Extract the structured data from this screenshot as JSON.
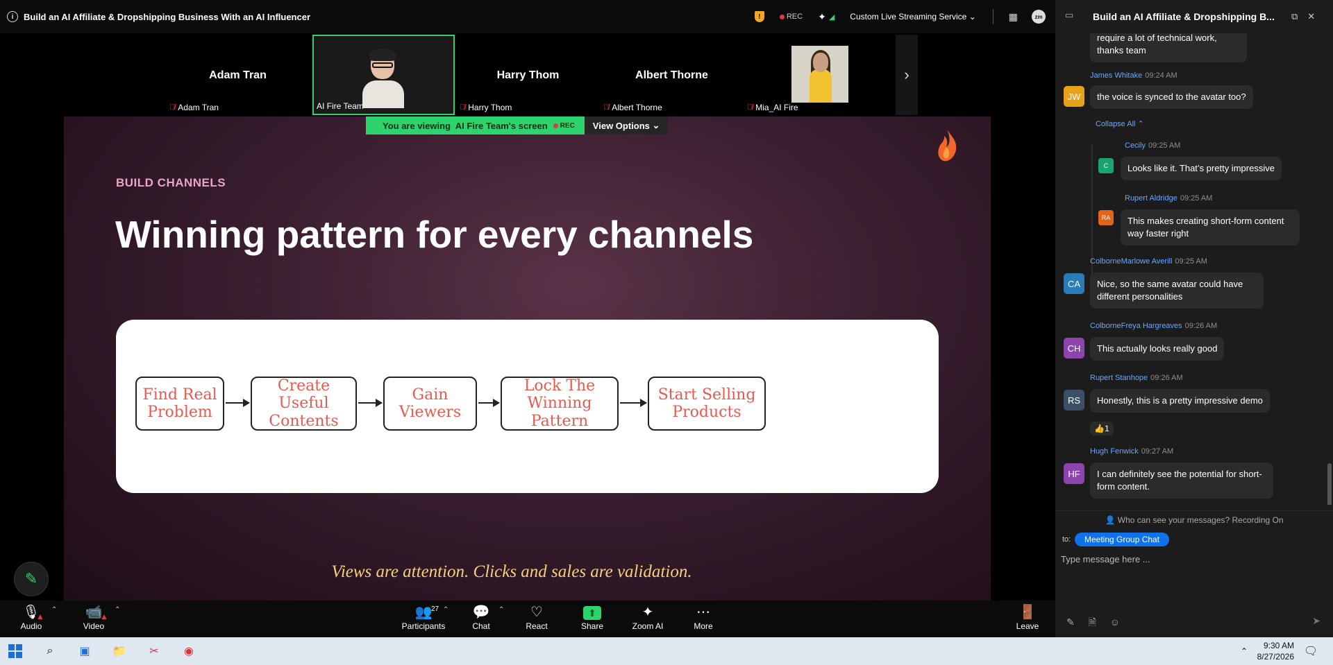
{
  "window": {
    "title": "Build an AI Affiliate & Dropshipping Business With an AI Influencer"
  },
  "titlebar": {
    "rec": "REC",
    "streaming_service": "Custom Live Streaming Service",
    "avatar_initials": "zm"
  },
  "participants_strip": [
    {
      "big_name": "Adam Tran",
      "tag": "Adam Tran",
      "muted": true
    },
    {
      "big_name": "",
      "tag": "AI Fire Team",
      "muted": false,
      "active": true
    },
    {
      "big_name": "Harry Thom",
      "tag": "Harry Thom",
      "muted": true
    },
    {
      "big_name": "Albert Thorne",
      "tag": "Albert Thorne",
      "muted": true
    },
    {
      "big_name": "",
      "tag": "Mia_AI Fire",
      "muted": true
    }
  ],
  "viewing_banner": {
    "text": "You are viewing  AI Fire Team's screen",
    "rec": "REC",
    "view_options": "View Options"
  },
  "slide": {
    "eyebrow": "BUILD CHANNELS",
    "headline": "Winning pattern for every channels",
    "steps": [
      "Find Real Problem",
      "Create Useful Contents",
      "Gain Viewers",
      "Lock The Winning Pattern",
      "Start Selling Products"
    ],
    "quote": "Views are attention. Clicks and sales are validation."
  },
  "toolbar": {
    "audio": "Audio",
    "video": "Video",
    "participants": "Participants",
    "participants_count": "27",
    "chat": "Chat",
    "react": "React",
    "share": "Share",
    "zoom_ai": "Zoom AI",
    "more": "More",
    "leave": "Leave"
  },
  "chat": {
    "title": "Build an AI Affiliate & Dropshipping B...",
    "top_fragment": "require a lot of technical work, thanks team",
    "collapse_all": "Collapse All",
    "messages": [
      {
        "initials": "JW",
        "name": "James Whitake",
        "time": "09:24 AM",
        "text": "the voice is synced to the avatar too?",
        "color": "#e8a21a"
      },
      {
        "initials": "C",
        "name": "Cecily",
        "time": "09:25 AM",
        "text": "Looks like it. That’s pretty impressive",
        "color": "#1aa46e"
      },
      {
        "initials": "RA",
        "name": "Rupert Aldridge",
        "time": "09:25 AM",
        "text": "This makes creating short-form content way faster right",
        "color": "#e0641a"
      },
      {
        "initials": "CA",
        "name": "ColborneMarlowe Averill",
        "time": "09:25 AM",
        "text": "Nice, so the same avatar could have different personalities",
        "color": "#2b7bb9"
      },
      {
        "initials": "CH",
        "name": "ColborneFreya Hargreaves",
        "time": "09:26 AM",
        "text": "This actually looks really good",
        "color": "#8e44ad"
      },
      {
        "initials": "RS",
        "name": "Rupert Stanhope",
        "time": "09:26 AM",
        "text": "Honestly, this is a pretty impressive demo",
        "color": "#3d4f66"
      },
      {
        "initials": "HF",
        "name": "Hugh Fenwick",
        "time": "09:27 AM",
        "text": "I can definitely see the potential for short-form content.",
        "color": "#8e44ad"
      }
    ],
    "reaction": "👍1",
    "who_can_see": "Who can see your messages? Recording On",
    "to_label": "to:",
    "recipient": "Meeting Group Chat",
    "placeholder": "Type message here ..."
  },
  "taskbar": {
    "time": "9:30 AM",
    "date": "8/27/2026"
  }
}
